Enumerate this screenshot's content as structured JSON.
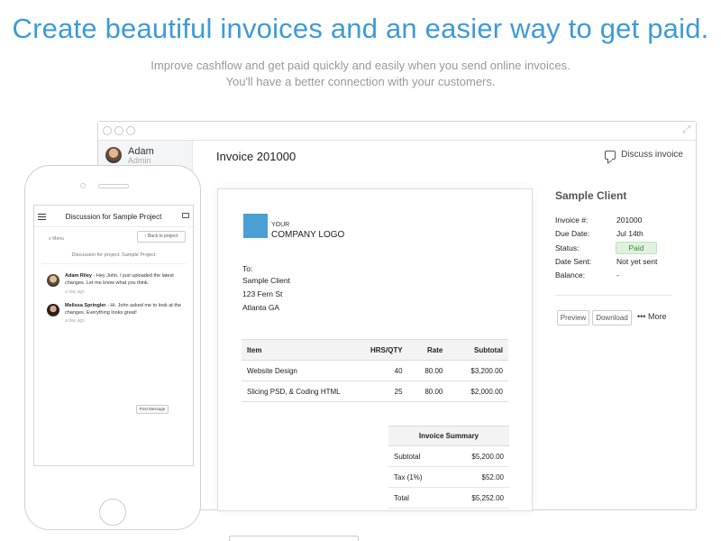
{
  "hero": {
    "title": "Create beautiful invoices and an easier way to get paid.",
    "subtitle_line1": "Improve cashflow and get paid quickly and easily when you send online invoices.",
    "subtitle_line2": "You'll have a better connection with your customers."
  },
  "app": {
    "user": {
      "name": "Adam",
      "role": "Admin"
    },
    "invoice_title": "Invoice 201000",
    "discuss_label": "Discuss invoice",
    "logo": {
      "small": "YOUR",
      "large": "COMPANY LOGO"
    },
    "to": {
      "label": "To:",
      "name": "Sample Client",
      "street": "123 Fern St",
      "city": "Atlanta GA"
    },
    "items": {
      "headers": {
        "item": "Item",
        "qty": "HRS/QTY",
        "rate": "Rate",
        "subtotal": "Subtotal"
      },
      "rows": [
        {
          "item": "Website Design",
          "qty": "40",
          "rate": "80.00",
          "subtotal": "$3,200.00"
        },
        {
          "item": "Slicing PSD, & Coding HTML",
          "qty": "25",
          "rate": "80.00",
          "subtotal": "$2,000.00"
        }
      ]
    },
    "summary": {
      "header": "Invoice Summary",
      "rows": [
        {
          "label": "Subtotal",
          "value": "$5,200.00"
        },
        {
          "label": "Tax (1%)",
          "value": "$52.00"
        },
        {
          "label": "Total",
          "value": "$5,252.00"
        }
      ]
    },
    "client": {
      "name": "Sample Client",
      "invoice_no_label": "Invoice #:",
      "invoice_no": "201000",
      "due_label": "Due Date:",
      "due": "Jul 14th",
      "status_label": "Status:",
      "status": "Paid",
      "sent_label": "Date Sent:",
      "sent": "Not yet sent",
      "balance_label": "Balance:",
      "balance": "-",
      "preview": "Preview",
      "download": "Download",
      "more": "••• More"
    }
  },
  "mobile": {
    "title": "Discussion for Sample Project",
    "menu": "≡ Menu",
    "back": "‹ Back to project",
    "discussion_label": "Discussion for project: Sample Project",
    "messages": [
      {
        "author": "Adam Riley",
        "text": " - Hey John. I just uploaded the latest changes. Let me know what you think.",
        "time": "a day ago"
      },
      {
        "author": "Melissa Springler",
        "text": " - Hi. John asked me to look at the changes. Everything looks great!",
        "time": "a day ago"
      }
    ],
    "post_button": "Post Message"
  },
  "colors": {
    "accent": "#3d9bd8",
    "logo": "#4a9fd5",
    "paid_bg": "#dff1df"
  },
  "icons": {
    "discuss": "chat-bubble-icon",
    "menu": "hamburger-icon",
    "expand": "expand-icon"
  }
}
